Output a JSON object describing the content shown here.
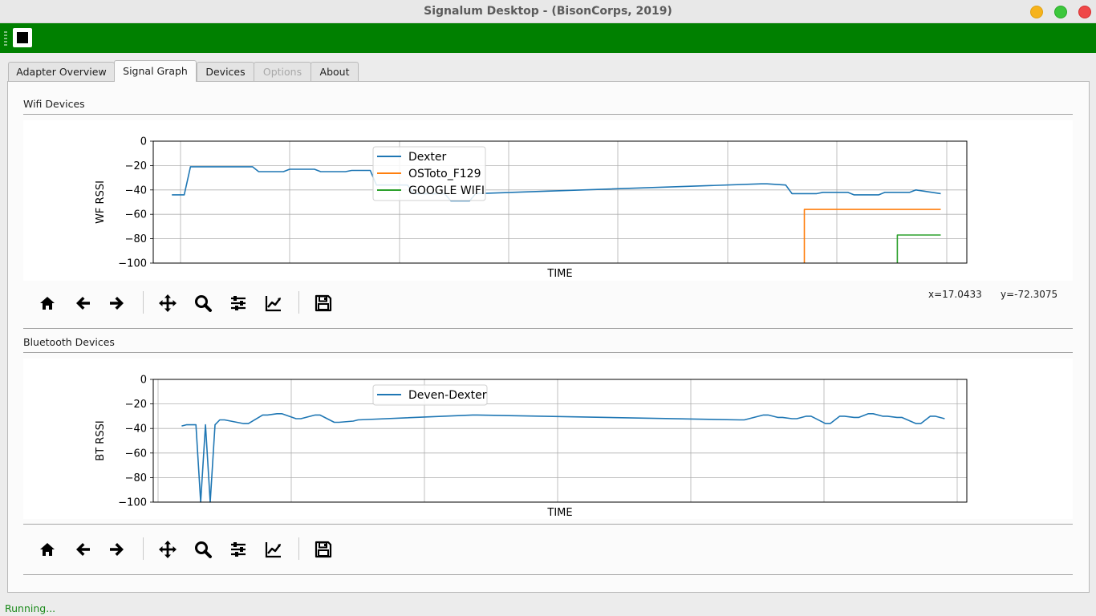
{
  "window": {
    "title": "Signalum Desktop - (BisonCorps, 2019)"
  },
  "tabs": [
    {
      "label": "Adapter Overview",
      "state": "normal"
    },
    {
      "label": "Signal Graph",
      "state": "active"
    },
    {
      "label": "Devices",
      "state": "normal"
    },
    {
      "label": "Options",
      "state": "disabled"
    },
    {
      "label": "About",
      "state": "normal"
    }
  ],
  "wifi": {
    "section_label": "Wifi Devices",
    "coords": {
      "x": "x=17.0433",
      "y": "y=-72.3075"
    }
  },
  "bluetooth": {
    "section_label": "Bluetooth Devices"
  },
  "plot_toolbar": [
    {
      "name": "home-icon",
      "label": "home"
    },
    {
      "name": "back-arrow-icon",
      "label": "back"
    },
    {
      "name": "forward-arrow-icon",
      "label": "forward"
    },
    {
      "name": "pan-icon",
      "label": "pan"
    },
    {
      "name": "zoom-icon",
      "label": "zoom"
    },
    {
      "name": "subplots-config-icon",
      "label": "configure subplots"
    },
    {
      "name": "edit-axis-icon",
      "label": "edit axis"
    },
    {
      "name": "save-icon",
      "label": "save"
    }
  ],
  "status": "Running...",
  "colors": {
    "toolbar_green": "#008000",
    "series_blue": "#1f77b4",
    "series_orange": "#ff7f0e",
    "series_green": "#2ca02c",
    "status_text": "#1a8a1a"
  },
  "chart_data": [
    {
      "type": "line",
      "xlabel": "TIME",
      "ylabel": "WF RSSI",
      "ylim": [
        -100,
        0
      ],
      "yticks": [
        "0",
        "−20",
        "−40",
        "−60",
        "−80",
        "−100"
      ],
      "grid": true,
      "legend": "top-center",
      "series": [
        {
          "name": "Dexter",
          "color": "#1f77b4",
          "x": [
            0,
            2,
            3,
            13,
            14,
            18,
            19,
            23,
            24,
            28,
            29,
            32,
            33,
            38,
            39,
            44,
            45,
            48,
            49,
            95,
            96,
            99,
            100,
            104,
            105,
            109,
            110,
            114,
            115,
            119,
            120,
            124
          ],
          "y": [
            -44,
            -44,
            -21,
            -21,
            -25,
            -25,
            -23,
            -23,
            -25,
            -25,
            -24,
            -24,
            -36,
            -36,
            -43,
            -43,
            -49,
            -49,
            -43,
            -35,
            -35,
            -36,
            -43,
            -43,
            -42,
            -42,
            -44,
            -44,
            -42,
            -42,
            -40,
            -43
          ]
        },
        {
          "name": "OSToto_F129",
          "color": "#ff7f0e",
          "x": [
            102,
            102,
            124
          ],
          "y": [
            -100,
            -56,
            -56
          ]
        },
        {
          "name": "GOOGLE WIFI",
          "color": "#2ca02c",
          "x": [
            117,
            117,
            124
          ],
          "y": [
            -100,
            -77,
            -77
          ]
        }
      ]
    },
    {
      "type": "line",
      "xlabel": "TIME",
      "ylabel": "BT RSSI",
      "ylim": [
        -100,
        0
      ],
      "yticks": [
        "0",
        "−20",
        "−40",
        "−60",
        "−80",
        "−100"
      ],
      "grid": true,
      "legend": "top-center",
      "series": [
        {
          "name": "Deven-Dexter",
          "color": "#1f77b4",
          "x": [
            0,
            1,
            2,
            3,
            4,
            5,
            6,
            7,
            8,
            9,
            13,
            14,
            17,
            18,
            20,
            21,
            24,
            25,
            28,
            29,
            32,
            33,
            36,
            37,
            61,
            62,
            117,
            118,
            122,
            123,
            125,
            126,
            128,
            129,
            131,
            132,
            135,
            136,
            138,
            139,
            141,
            142,
            144,
            145,
            147,
            148,
            150,
            151,
            154,
            155,
            157,
            158,
            160
          ],
          "y": [
            -38,
            -37,
            -37,
            -37,
            -100,
            -37,
            -100,
            -37,
            -33,
            -33,
            -36,
            -36,
            -29,
            -29,
            -28,
            -28,
            -32,
            -32,
            -29,
            -29,
            -35,
            -35,
            -34,
            -33,
            -29,
            -29,
            -33,
            -33,
            -29,
            -29,
            -31,
            -31,
            -32,
            -32,
            -30,
            -30,
            -36,
            -36,
            -30,
            -30,
            -31,
            -31,
            -28,
            -28,
            -30,
            -30,
            -31,
            -31,
            -36,
            -36,
            -30,
            -30,
            -32
          ]
        }
      ]
    }
  ]
}
